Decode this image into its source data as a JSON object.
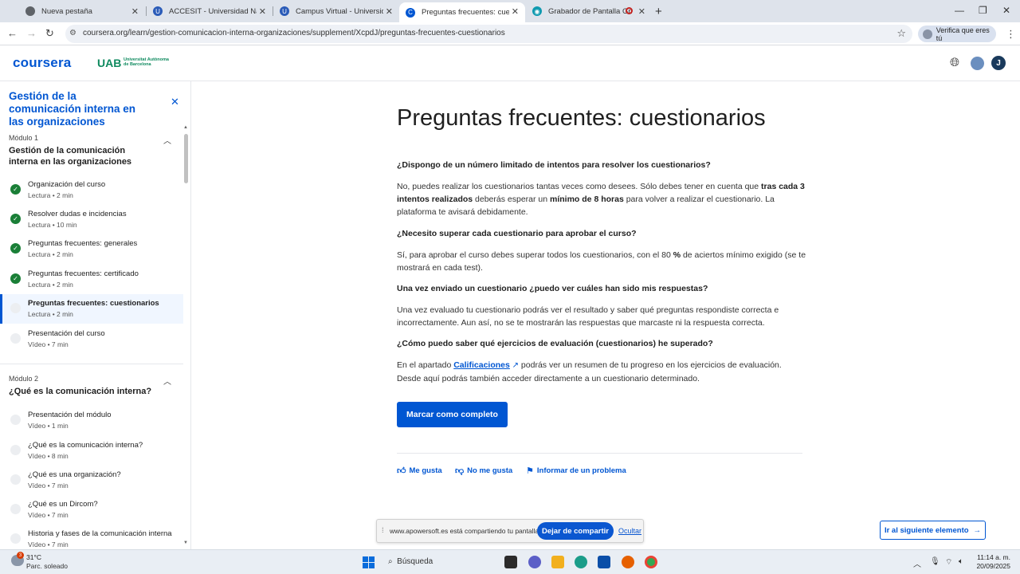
{
  "browser": {
    "tabs": [
      {
        "title": "Nueva pestaña",
        "icon": "chrome-icon"
      },
      {
        "title": "ACCESIT - Universidad Nacional",
        "icon": "u-icon"
      },
      {
        "title": "Campus Virtual - Universidad N",
        "icon": "u-icon"
      },
      {
        "title": "Preguntas frecuentes: cuestion",
        "icon": "coursera-icon",
        "active": true
      },
      {
        "title": "Grabador de Pantalla Gratis",
        "icon": "recorder-icon",
        "recording": true
      }
    ],
    "url": "coursera.org/learn/gestion-comunicacion-interna-organizaciones/supplement/XcpdJ/preguntas-frecuentes-cuestionarios",
    "verify_label": "Verifica que eres tú"
  },
  "header": {
    "logo": "coursera",
    "partner": "UAB",
    "partner_sub": "Universitat Autònoma de Barcelona",
    "avatar_initial": "J"
  },
  "sidebar": {
    "course_title": "Gestión de la comunicación interna en las organizaciones",
    "modules": [
      {
        "label": "Módulo 1",
        "title": "Gestión de la comunicación interna en las organizaciones",
        "items": [
          {
            "name": "Organización del curso",
            "meta": "Lectura • 2 min",
            "done": true
          },
          {
            "name": "Resolver dudas e incidencias",
            "meta": "Lectura • 10 min",
            "done": true
          },
          {
            "name": "Preguntas frecuentes: generales",
            "meta": "Lectura • 2 min",
            "done": true
          },
          {
            "name": "Preguntas frecuentes: certificado",
            "meta": "Lectura • 2 min",
            "done": true
          },
          {
            "name": "Preguntas frecuentes: cuestionarios",
            "meta": "Lectura • 2 min",
            "done": false,
            "active": true
          },
          {
            "name": "Presentación del curso",
            "meta": "Vídeo • 7 min",
            "done": false
          }
        ]
      },
      {
        "label": "Módulo 2",
        "title": "¿Qué es la comunicación interna?",
        "items": [
          {
            "name": "Presentación del módulo",
            "meta": "Vídeo • 1 min",
            "done": false
          },
          {
            "name": "¿Qué es la comunicación interna?",
            "meta": "Vídeo • 8 min",
            "done": false
          },
          {
            "name": "¿Qué es una organización?",
            "meta": "Vídeo • 7 min",
            "done": false
          },
          {
            "name": "¿Qué es un Dircom?",
            "meta": "Vídeo • 7 min",
            "done": false
          },
          {
            "name": "Historia y fases de la comunicación interna",
            "meta": "Vídeo • 7 min",
            "done": false
          }
        ]
      }
    ]
  },
  "content": {
    "title": "Preguntas frecuentes: cuestionarios",
    "faq": [
      {
        "q": "¿Dispongo de un número limitado de intentos para resolver los cuestionarios?",
        "a_parts": [
          {
            "t": "No, puedes realizar los cuestionarios tantas veces como desees. Sólo debes tener en cuenta que "
          },
          {
            "t": "tras cada 3 intentos realizados",
            "b": true
          },
          {
            "t": " deberás esperar un "
          },
          {
            "t": "mínimo de 8 horas",
            "b": true
          },
          {
            "t": " para volver a realizar el cuestionario. La plataforma te avisará debidamente."
          }
        ]
      },
      {
        "q": "¿Necesito superar cada cuestionario para aprobar el curso?",
        "a_parts": [
          {
            "t": "Sí, para aprobar el curso debes superar todos los cuestionarios, con el 80 "
          },
          {
            "t": "%",
            "b": true
          },
          {
            "t": " de aciertos mínimo exigido (se te mostrará en cada test)."
          }
        ]
      },
      {
        "q": "Una vez enviado un cuestionario ¿puedo ver cuáles han sido mis respuestas?",
        "a_parts": [
          {
            "t": "Una vez evaluado tu cuestionario podrás ver el resultado y saber qué preguntas respondiste correcta e incorrectamente. Aun así, no se te mostrarán las respuestas que marcaste ni la respuesta correcta."
          }
        ]
      },
      {
        "q": "¿Cómo puedo saber qué ejercicios de evaluación (cuestionarios) he superado?",
        "a_parts": [
          {
            "t": "En el apartado "
          },
          {
            "t": "Calificaciones",
            "link": true
          },
          {
            "t": " ↗",
            "ext": true
          },
          {
            "t": " podrás ver un resumen de tu progreso en los ejercicios de evaluación. Desde aquí podrás también acceder directamente a un cuestionario determinado."
          }
        ]
      }
    ],
    "complete_button": "Marcar como completo",
    "feedback": {
      "like": "Me gusta",
      "dislike": "No me gusta",
      "report": "Informar de un problema"
    },
    "next_button": "Ir al siguiente elemento"
  },
  "sharebar": {
    "message": "www.apowersoft.es está compartiendo tu pantalla.",
    "stop": "Dejar de compartir",
    "hide": "Ocultar"
  },
  "taskbar": {
    "temp": "31°C",
    "condition": "Parc. soleado",
    "weather_badge": "3",
    "search": "Búsqueda",
    "time": "11:14 a. m.",
    "date": "20/09/2025"
  }
}
